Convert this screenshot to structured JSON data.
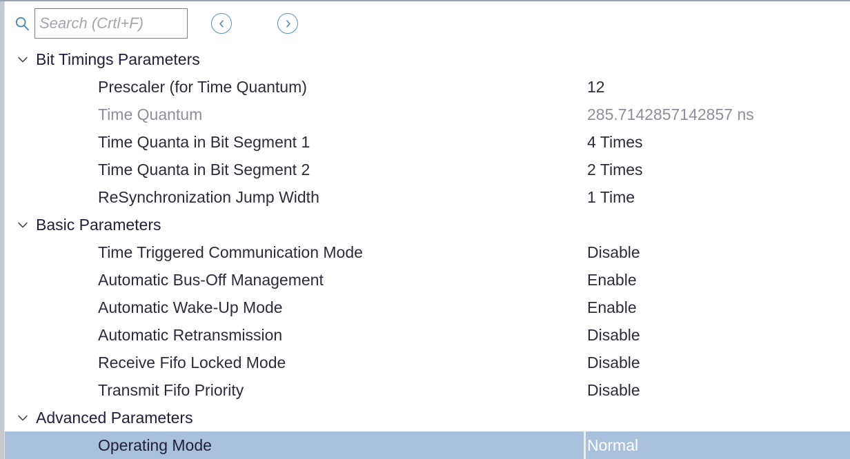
{
  "toolbar": {
    "search_icon": "search-icon",
    "search_value": "",
    "search_placeholder": "Search (Crtl+F)",
    "prev_icon": "chevron-left-circle-icon",
    "next_icon": "chevron-right-circle-icon"
  },
  "colors": {
    "selection": "#a8c2dd",
    "accent": "#5b8fb0",
    "label": "#2b2b3a",
    "disabled": "#8e8e9a",
    "background": "#ffffff",
    "border": "#9aa3ad"
  },
  "tree": [
    {
      "type": "group",
      "label": "Bit Timings Parameters",
      "expanded": true,
      "chevron": "chevron-down-icon"
    },
    {
      "type": "property",
      "label": "Prescaler (for Time Quantum)",
      "value": "12",
      "disabled": false,
      "selected": false
    },
    {
      "type": "property",
      "label": "Time Quantum",
      "value": "285.7142857142857 ns",
      "disabled": true,
      "selected": false
    },
    {
      "type": "property",
      "label": "Time Quanta in Bit Segment 1",
      "value": "4 Times",
      "disabled": false,
      "selected": false
    },
    {
      "type": "property",
      "label": "Time Quanta in Bit Segment 2",
      "value": "2 Times",
      "disabled": false,
      "selected": false
    },
    {
      "type": "property",
      "label": "ReSynchronization Jump Width",
      "value": "1 Time",
      "disabled": false,
      "selected": false
    },
    {
      "type": "group",
      "label": "Basic Parameters",
      "expanded": true,
      "chevron": "chevron-down-icon"
    },
    {
      "type": "property",
      "label": "Time Triggered Communication Mode",
      "value": "Disable",
      "disabled": false,
      "selected": false
    },
    {
      "type": "property",
      "label": "Automatic Bus-Off Management",
      "value": "Enable",
      "disabled": false,
      "selected": false
    },
    {
      "type": "property",
      "label": "Automatic Wake-Up Mode",
      "value": "Enable",
      "disabled": false,
      "selected": false
    },
    {
      "type": "property",
      "label": "Automatic Retransmission",
      "value": "Disable",
      "disabled": false,
      "selected": false
    },
    {
      "type": "property",
      "label": "Receive Fifo Locked Mode",
      "value": "Disable",
      "disabled": false,
      "selected": false
    },
    {
      "type": "property",
      "label": "Transmit Fifo Priority",
      "value": "Disable",
      "disabled": false,
      "selected": false
    },
    {
      "type": "group",
      "label": "Advanced Parameters",
      "expanded": true,
      "chevron": "chevron-down-icon"
    },
    {
      "type": "property",
      "label": "Operating Mode",
      "value": "Normal",
      "disabled": false,
      "selected": true
    }
  ]
}
